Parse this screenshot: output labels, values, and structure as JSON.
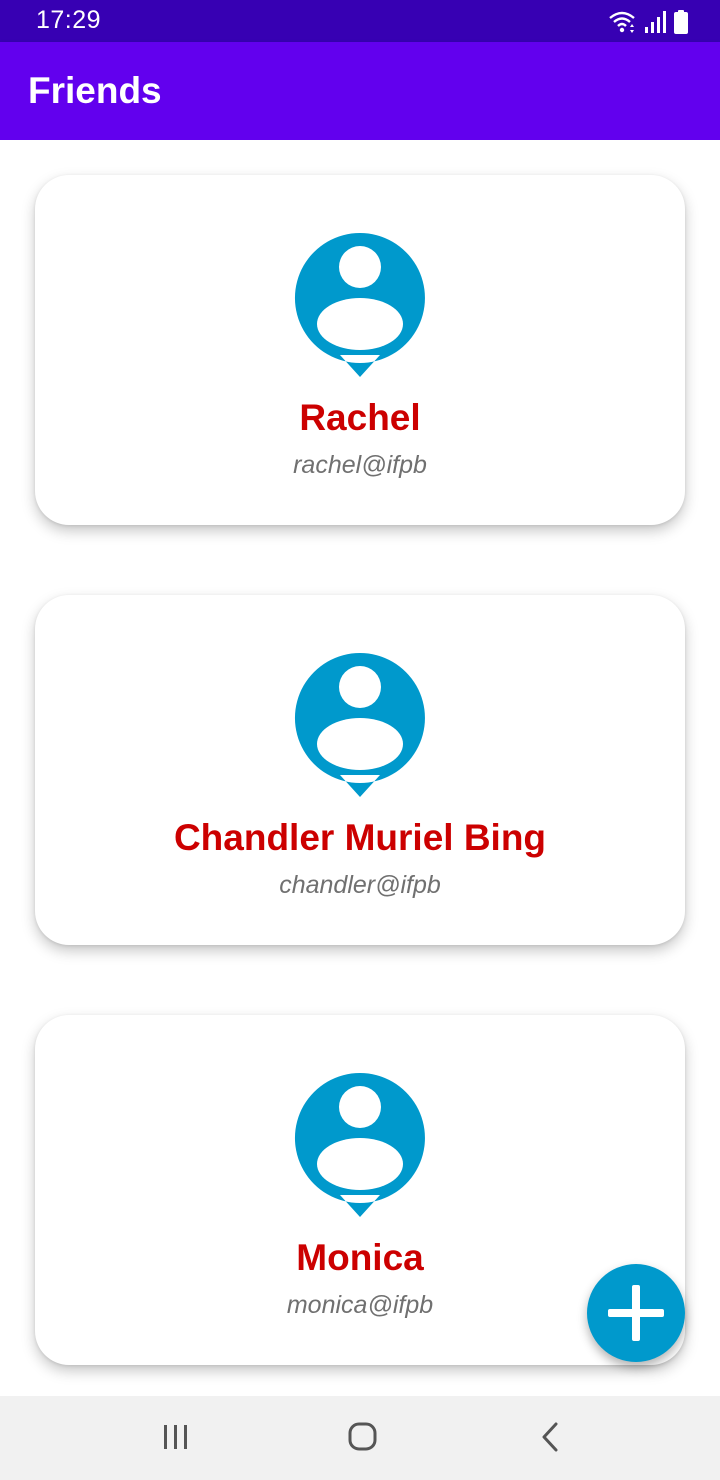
{
  "status_bar": {
    "time": "17:29",
    "icons": [
      "wifi-icon",
      "signal-icon",
      "battery-icon"
    ],
    "background": "#3700b3"
  },
  "app_bar": {
    "title": "Friends",
    "background": "#6200ee"
  },
  "friends": [
    {
      "name": "Rachel",
      "email": "rachel@ifpb",
      "icon": "person-pin-icon"
    },
    {
      "name": "Chandler Muriel Bing",
      "email": "chandler@ifpb",
      "icon": "person-pin-icon"
    },
    {
      "name": "Monica",
      "email": "monica@ifpb",
      "icon": "person-pin-icon"
    }
  ],
  "fab": {
    "icon": "plus-icon",
    "background": "#0099cc"
  },
  "nav_bar": {
    "buttons": [
      "recent-apps-icon",
      "home-icon",
      "back-icon"
    ]
  },
  "colors": {
    "name": "#cc0000",
    "email": "#707070",
    "avatar": "#0099cc"
  }
}
